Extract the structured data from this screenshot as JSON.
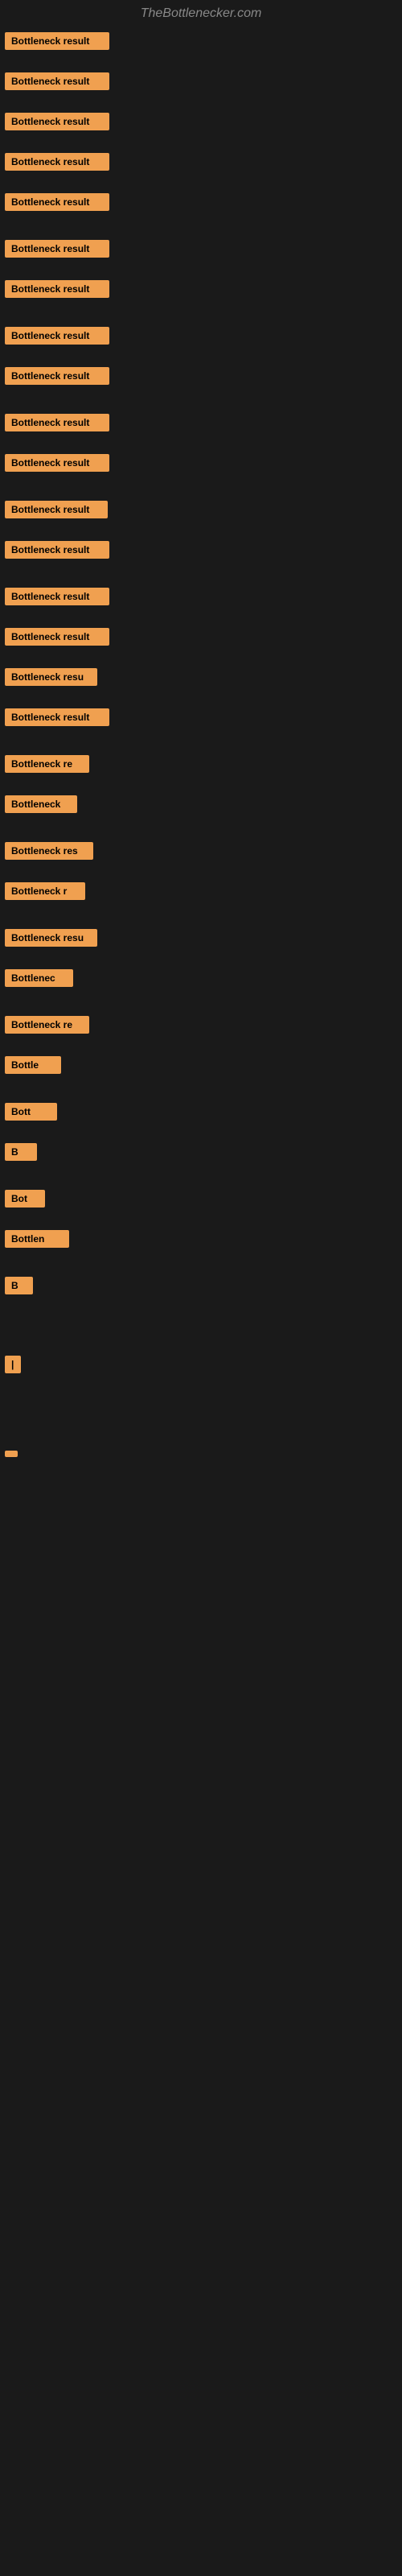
{
  "site": {
    "title": "TheBottlenecker.com"
  },
  "items": [
    {
      "id": 1,
      "label": "Bottleneck result",
      "width_class": "badge-full",
      "gap_after": 12
    },
    {
      "id": 2,
      "label": "Bottleneck result",
      "width_class": "badge-full",
      "gap_after": 12
    },
    {
      "id": 3,
      "label": "Bottleneck result",
      "width_class": "badge-full",
      "gap_after": 12
    },
    {
      "id": 4,
      "label": "Bottleneck result",
      "width_class": "badge-full",
      "gap_after": 12
    },
    {
      "id": 5,
      "label": "Bottleneck result",
      "width_class": "badge-full",
      "gap_after": 20
    },
    {
      "id": 6,
      "label": "Bottleneck result",
      "width_class": "badge-full",
      "gap_after": 12
    },
    {
      "id": 7,
      "label": "Bottleneck result",
      "width_class": "badge-full",
      "gap_after": 20
    },
    {
      "id": 8,
      "label": "Bottleneck result",
      "width_class": "badge-full",
      "gap_after": 12
    },
    {
      "id": 9,
      "label": "Bottleneck result",
      "width_class": "badge-full",
      "gap_after": 20
    },
    {
      "id": 10,
      "label": "Bottleneck result",
      "width_class": "badge-full",
      "gap_after": 12
    },
    {
      "id": 11,
      "label": "Bottleneck result",
      "width_class": "badge-full",
      "gap_after": 20
    },
    {
      "id": 12,
      "label": "Bottleneck result",
      "width_class": "badge-w1",
      "gap_after": 12
    },
    {
      "id": 13,
      "label": "Bottleneck result",
      "width_class": "badge-full",
      "gap_after": 20
    },
    {
      "id": 14,
      "label": "Bottleneck result",
      "width_class": "badge-full",
      "gap_after": 12
    },
    {
      "id": 15,
      "label": "Bottleneck result",
      "width_class": "badge-full",
      "gap_after": 12
    },
    {
      "id": 16,
      "label": "Bottleneck resu",
      "width_class": "badge-w4",
      "gap_after": 12
    },
    {
      "id": 17,
      "label": "Bottleneck result",
      "width_class": "badge-full",
      "gap_after": 20
    },
    {
      "id": 18,
      "label": "Bottleneck re",
      "width_class": "badge-w6",
      "gap_after": 12
    },
    {
      "id": 19,
      "label": "Bottleneck",
      "width_class": "badge-w9",
      "gap_after": 20
    },
    {
      "id": 20,
      "label": "Bottleneck res",
      "width_class": "badge-w5",
      "gap_after": 12
    },
    {
      "id": 21,
      "label": "Bottleneck r",
      "width_class": "badge-w7",
      "gap_after": 20
    },
    {
      "id": 22,
      "label": "Bottleneck resu",
      "width_class": "badge-w4",
      "gap_after": 12
    },
    {
      "id": 23,
      "label": "Bottlenec",
      "width_class": "badge-w10",
      "gap_after": 20
    },
    {
      "id": 24,
      "label": "Bottleneck re",
      "width_class": "badge-w6",
      "gap_after": 12
    },
    {
      "id": 25,
      "label": "Bottle",
      "width_class": "badge-w12",
      "gap_after": 20
    },
    {
      "id": 26,
      "label": "Bott",
      "width_class": "badge-w13",
      "gap_after": 12
    },
    {
      "id": 27,
      "label": "B",
      "width_class": "badge-w16",
      "gap_after": 20
    },
    {
      "id": 28,
      "label": "Bot",
      "width_class": "badge-w15",
      "gap_after": 12
    },
    {
      "id": 29,
      "label": "Bottlen",
      "width_class": "badge-w11",
      "gap_after": 20
    },
    {
      "id": 30,
      "label": "B",
      "width_class": "badge-w17",
      "gap_after": 60
    },
    {
      "id": 31,
      "label": "|",
      "width_class": "badge-w19",
      "gap_after": 80
    },
    {
      "id": 32,
      "label": "",
      "width_class": "badge-w20",
      "gap_after": 80
    }
  ],
  "colors": {
    "badge_bg": "#f0a050",
    "badge_text": "#000000",
    "background": "#1a1a1a",
    "title": "#888888"
  }
}
